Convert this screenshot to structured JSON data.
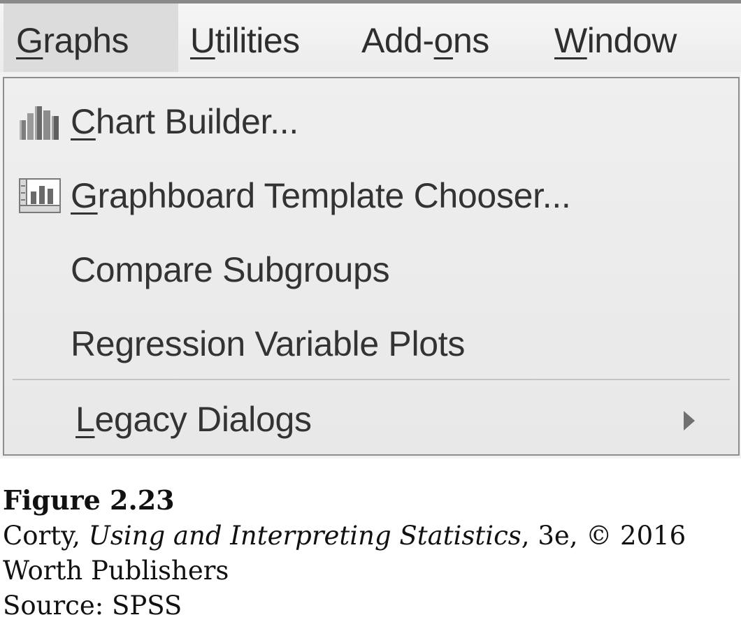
{
  "menubar": {
    "items": [
      {
        "label": "Graphs"
      },
      {
        "label": "Utilities"
      },
      {
        "label": "Add-ons"
      },
      {
        "label": "Window"
      }
    ]
  },
  "graphs_menu": {
    "items": [
      {
        "label": "Chart Builder...",
        "icon": "chart-builder-icon"
      },
      {
        "label": "Graphboard Template Chooser...",
        "icon": "graphboard-icon"
      },
      {
        "label": "Compare Subgroups"
      },
      {
        "label": "Regression Variable Plots"
      },
      {
        "label": "Legacy Dialogs",
        "has_submenu": true
      }
    ]
  },
  "caption": {
    "figure": "Figure 2.23",
    "author": "Corty, ",
    "book_title": "Using and Interpreting Statistics",
    "edition": ", 3e, © 2016",
    "publisher": "Worth Publishers",
    "source": "Source: SPSS"
  },
  "colors": {
    "menu_background": "#efefef",
    "open_menu_highlight": "#dcdcdc",
    "border": "#8e8e8e",
    "text": "#333333"
  }
}
